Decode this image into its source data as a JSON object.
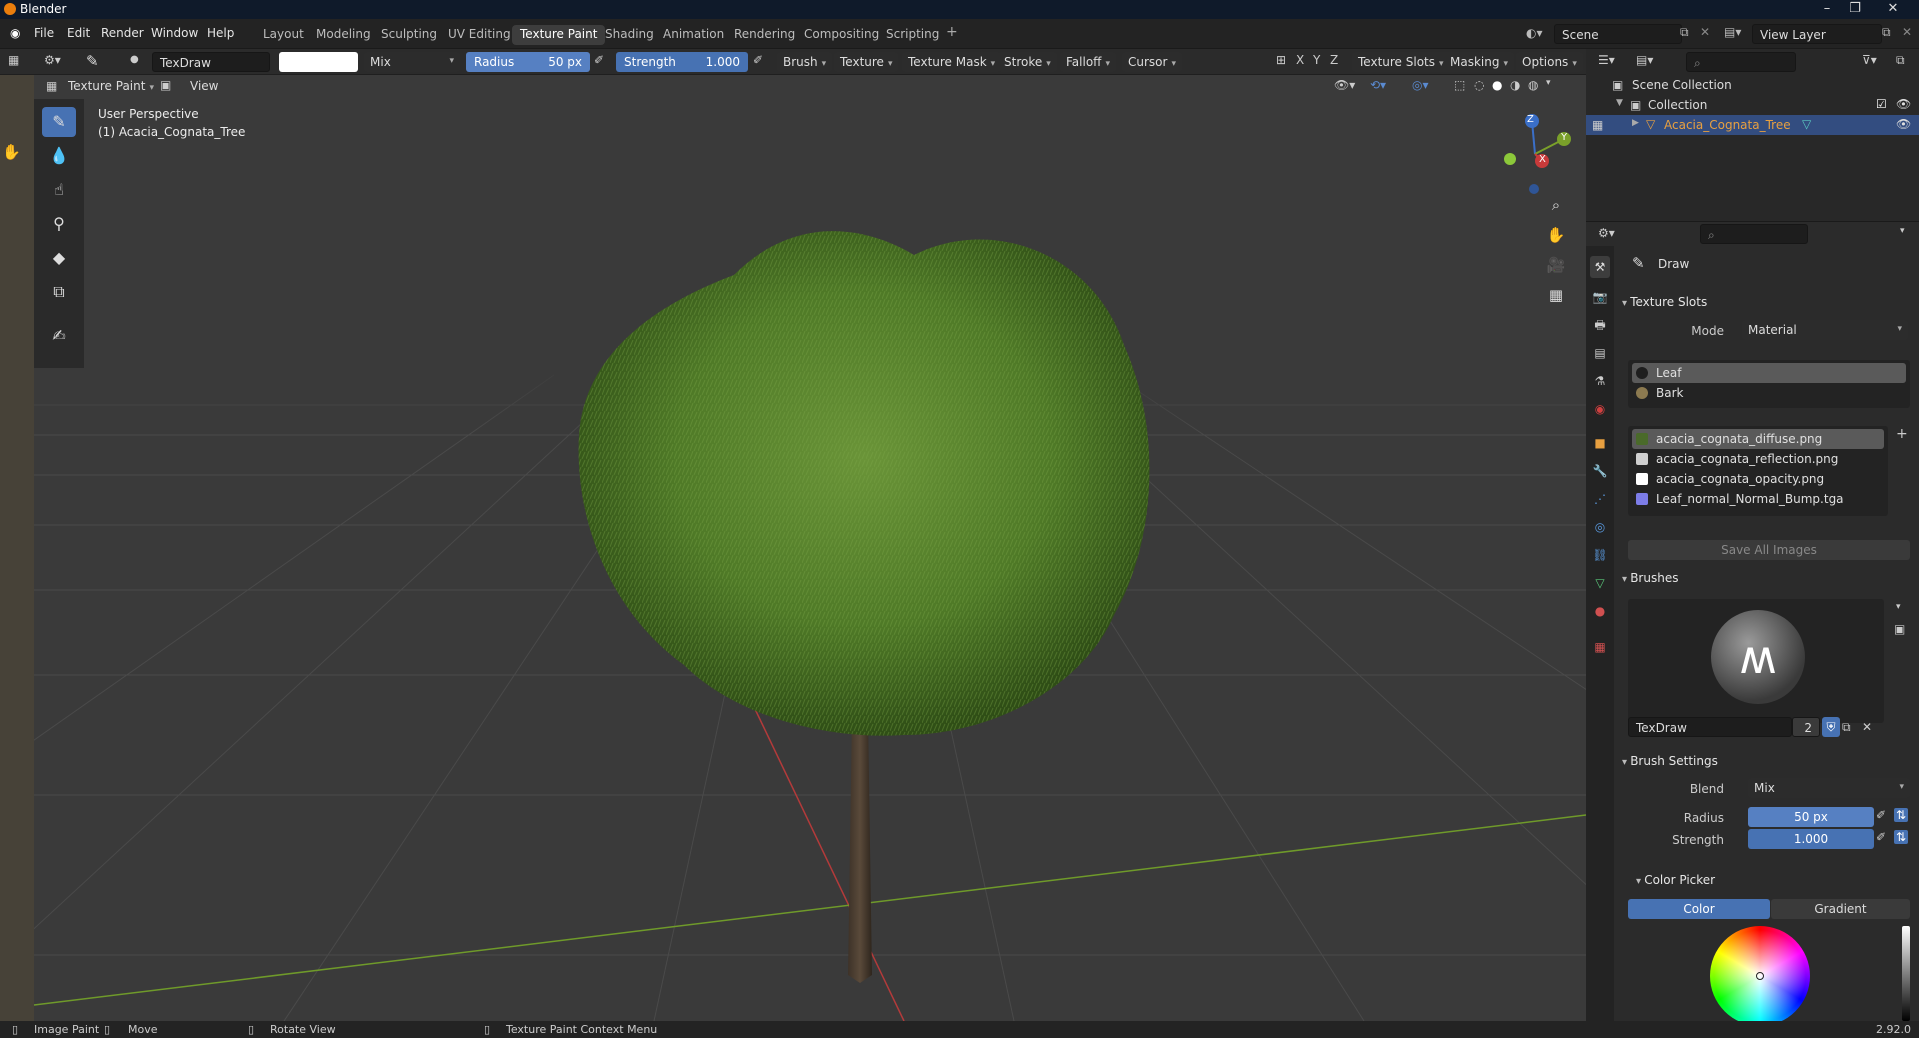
{
  "app": {
    "title": "Blender",
    "version": "2.92.0"
  },
  "menu": [
    "File",
    "Edit",
    "Render",
    "Window",
    "Help"
  ],
  "workspaces": [
    "Layout",
    "Modeling",
    "Sculpting",
    "UV Editing",
    "Texture Paint",
    "Shading",
    "Animation",
    "Rendering",
    "Compositing",
    "Scripting"
  ],
  "scene": "Scene",
  "view_layer": "View Layer",
  "tool_header": {
    "brush_name": "TexDraw",
    "blend": "Mix",
    "radius_label": "Radius",
    "radius_value": "50 px",
    "strength_label": "Strength",
    "strength_value": "1.000",
    "menus": [
      "Brush",
      "Texture",
      "Texture Mask",
      "Stroke",
      "Falloff",
      "Cursor"
    ],
    "right_menus": [
      "Texture Slots",
      "Masking",
      "Options"
    ],
    "axes": [
      "X",
      "Y",
      "Z"
    ]
  },
  "viewport_header": {
    "mode": "Texture Paint",
    "view": "View"
  },
  "viewport": {
    "perspective": "User Perspective",
    "object": "(1) Acacia_Cognata_Tree",
    "gizmo": {
      "z": "Z",
      "y": "Y",
      "x": "X"
    }
  },
  "outliner": {
    "scene_collection": "Scene Collection",
    "collection": "Collection",
    "object": "Acacia_Cognata_Tree"
  },
  "properties": {
    "tool_name": "Draw",
    "texture_slots": {
      "header": "Texture Slots",
      "mode_label": "Mode",
      "mode_value": "Material",
      "materials": [
        {
          "name": "Leaf",
          "color": "#1e1e1e"
        },
        {
          "name": "Bark",
          "color": "#8c7a50"
        }
      ],
      "images": [
        {
          "name": "acacia_cognata_diffuse.png",
          "color": "#4a6a2a"
        },
        {
          "name": "acacia_cognata_reflection.png",
          "color": "#cfcfcf"
        },
        {
          "name": "acacia_cognata_opacity.png",
          "color": "#ffffff"
        },
        {
          "name": "Leaf_normal_Normal_Bump.tga",
          "color": "#7d7de8"
        }
      ],
      "save_all": "Save All Images"
    },
    "brushes": {
      "header": "Brushes",
      "brush_name": "TexDraw",
      "users": "2"
    },
    "brush_settings": {
      "header": "Brush Settings",
      "blend_label": "Blend",
      "blend_value": "Mix",
      "radius_label": "Radius",
      "radius_value": "50 px",
      "strength_label": "Strength",
      "strength_value": "1.000"
    },
    "color_picker": {
      "header": "Color Picker",
      "tabs": [
        "Color",
        "Gradient"
      ]
    }
  },
  "statusbar": {
    "items": [
      "Image Paint",
      "Move",
      "Rotate View",
      "Texture Paint Context Menu"
    ]
  },
  "colors": {
    "accent": "#4772b3",
    "selection": "#334d80",
    "background": "#303030"
  }
}
